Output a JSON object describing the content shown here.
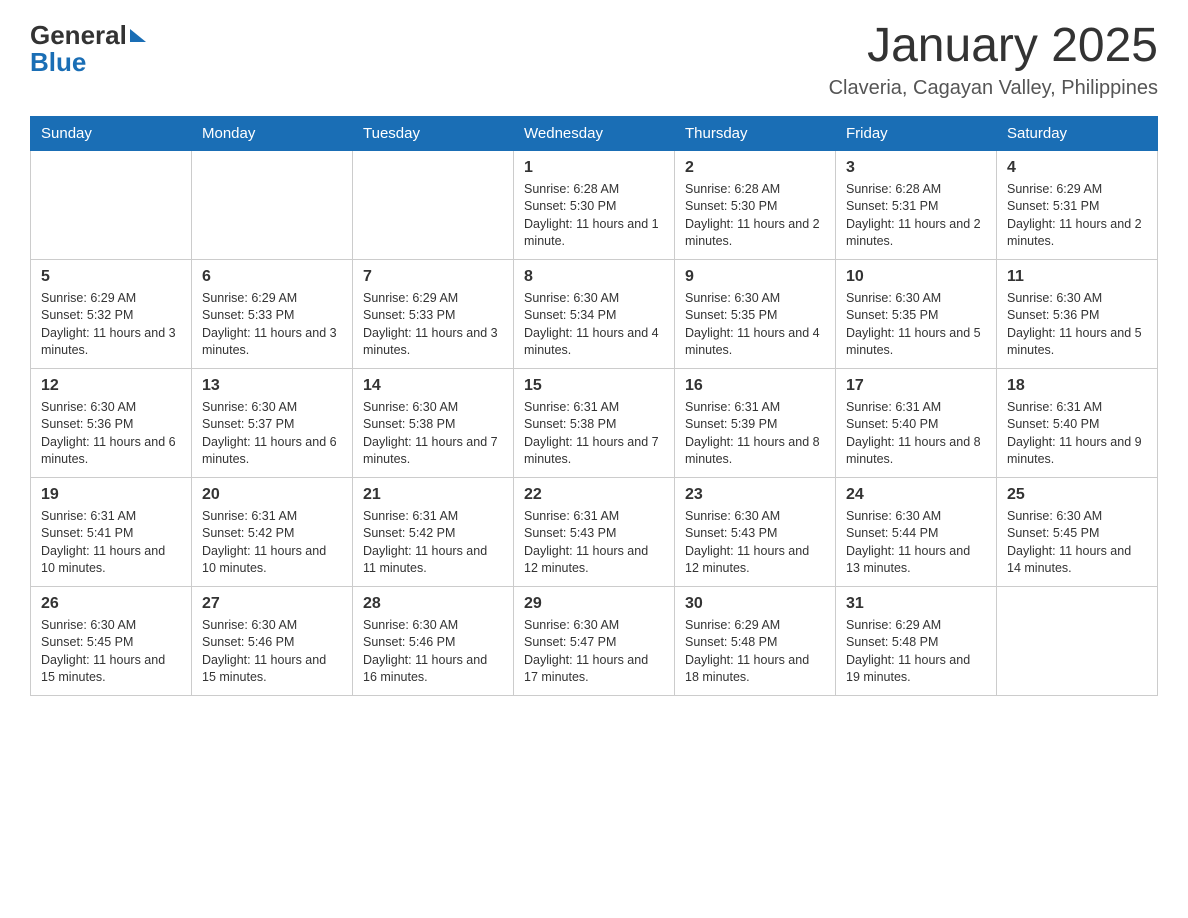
{
  "header": {
    "logo": {
      "text_general": "General",
      "text_blue": "Blue",
      "arrow_symbol": "▶"
    },
    "title": "January 2025",
    "location": "Claveria, Cagayan Valley, Philippines"
  },
  "calendar": {
    "days_of_week": [
      "Sunday",
      "Monday",
      "Tuesday",
      "Wednesday",
      "Thursday",
      "Friday",
      "Saturday"
    ],
    "weeks": [
      {
        "days": [
          {
            "number": "",
            "info": ""
          },
          {
            "number": "",
            "info": ""
          },
          {
            "number": "",
            "info": ""
          },
          {
            "number": "1",
            "info": "Sunrise: 6:28 AM\nSunset: 5:30 PM\nDaylight: 11 hours and 1 minute."
          },
          {
            "number": "2",
            "info": "Sunrise: 6:28 AM\nSunset: 5:30 PM\nDaylight: 11 hours and 2 minutes."
          },
          {
            "number": "3",
            "info": "Sunrise: 6:28 AM\nSunset: 5:31 PM\nDaylight: 11 hours and 2 minutes."
          },
          {
            "number": "4",
            "info": "Sunrise: 6:29 AM\nSunset: 5:31 PM\nDaylight: 11 hours and 2 minutes."
          }
        ]
      },
      {
        "days": [
          {
            "number": "5",
            "info": "Sunrise: 6:29 AM\nSunset: 5:32 PM\nDaylight: 11 hours and 3 minutes."
          },
          {
            "number": "6",
            "info": "Sunrise: 6:29 AM\nSunset: 5:33 PM\nDaylight: 11 hours and 3 minutes."
          },
          {
            "number": "7",
            "info": "Sunrise: 6:29 AM\nSunset: 5:33 PM\nDaylight: 11 hours and 3 minutes."
          },
          {
            "number": "8",
            "info": "Sunrise: 6:30 AM\nSunset: 5:34 PM\nDaylight: 11 hours and 4 minutes."
          },
          {
            "number": "9",
            "info": "Sunrise: 6:30 AM\nSunset: 5:35 PM\nDaylight: 11 hours and 4 minutes."
          },
          {
            "number": "10",
            "info": "Sunrise: 6:30 AM\nSunset: 5:35 PM\nDaylight: 11 hours and 5 minutes."
          },
          {
            "number": "11",
            "info": "Sunrise: 6:30 AM\nSunset: 5:36 PM\nDaylight: 11 hours and 5 minutes."
          }
        ]
      },
      {
        "days": [
          {
            "number": "12",
            "info": "Sunrise: 6:30 AM\nSunset: 5:36 PM\nDaylight: 11 hours and 6 minutes."
          },
          {
            "number": "13",
            "info": "Sunrise: 6:30 AM\nSunset: 5:37 PM\nDaylight: 11 hours and 6 minutes."
          },
          {
            "number": "14",
            "info": "Sunrise: 6:30 AM\nSunset: 5:38 PM\nDaylight: 11 hours and 7 minutes."
          },
          {
            "number": "15",
            "info": "Sunrise: 6:31 AM\nSunset: 5:38 PM\nDaylight: 11 hours and 7 minutes."
          },
          {
            "number": "16",
            "info": "Sunrise: 6:31 AM\nSunset: 5:39 PM\nDaylight: 11 hours and 8 minutes."
          },
          {
            "number": "17",
            "info": "Sunrise: 6:31 AM\nSunset: 5:40 PM\nDaylight: 11 hours and 8 minutes."
          },
          {
            "number": "18",
            "info": "Sunrise: 6:31 AM\nSunset: 5:40 PM\nDaylight: 11 hours and 9 minutes."
          }
        ]
      },
      {
        "days": [
          {
            "number": "19",
            "info": "Sunrise: 6:31 AM\nSunset: 5:41 PM\nDaylight: 11 hours and 10 minutes."
          },
          {
            "number": "20",
            "info": "Sunrise: 6:31 AM\nSunset: 5:42 PM\nDaylight: 11 hours and 10 minutes."
          },
          {
            "number": "21",
            "info": "Sunrise: 6:31 AM\nSunset: 5:42 PM\nDaylight: 11 hours and 11 minutes."
          },
          {
            "number": "22",
            "info": "Sunrise: 6:31 AM\nSunset: 5:43 PM\nDaylight: 11 hours and 12 minutes."
          },
          {
            "number": "23",
            "info": "Sunrise: 6:30 AM\nSunset: 5:43 PM\nDaylight: 11 hours and 12 minutes."
          },
          {
            "number": "24",
            "info": "Sunrise: 6:30 AM\nSunset: 5:44 PM\nDaylight: 11 hours and 13 minutes."
          },
          {
            "number": "25",
            "info": "Sunrise: 6:30 AM\nSunset: 5:45 PM\nDaylight: 11 hours and 14 minutes."
          }
        ]
      },
      {
        "days": [
          {
            "number": "26",
            "info": "Sunrise: 6:30 AM\nSunset: 5:45 PM\nDaylight: 11 hours and 15 minutes."
          },
          {
            "number": "27",
            "info": "Sunrise: 6:30 AM\nSunset: 5:46 PM\nDaylight: 11 hours and 15 minutes."
          },
          {
            "number": "28",
            "info": "Sunrise: 6:30 AM\nSunset: 5:46 PM\nDaylight: 11 hours and 16 minutes."
          },
          {
            "number": "29",
            "info": "Sunrise: 6:30 AM\nSunset: 5:47 PM\nDaylight: 11 hours and 17 minutes."
          },
          {
            "number": "30",
            "info": "Sunrise: 6:29 AM\nSunset: 5:48 PM\nDaylight: 11 hours and 18 minutes."
          },
          {
            "number": "31",
            "info": "Sunrise: 6:29 AM\nSunset: 5:48 PM\nDaylight: 11 hours and 19 minutes."
          },
          {
            "number": "",
            "info": ""
          }
        ]
      }
    ]
  }
}
